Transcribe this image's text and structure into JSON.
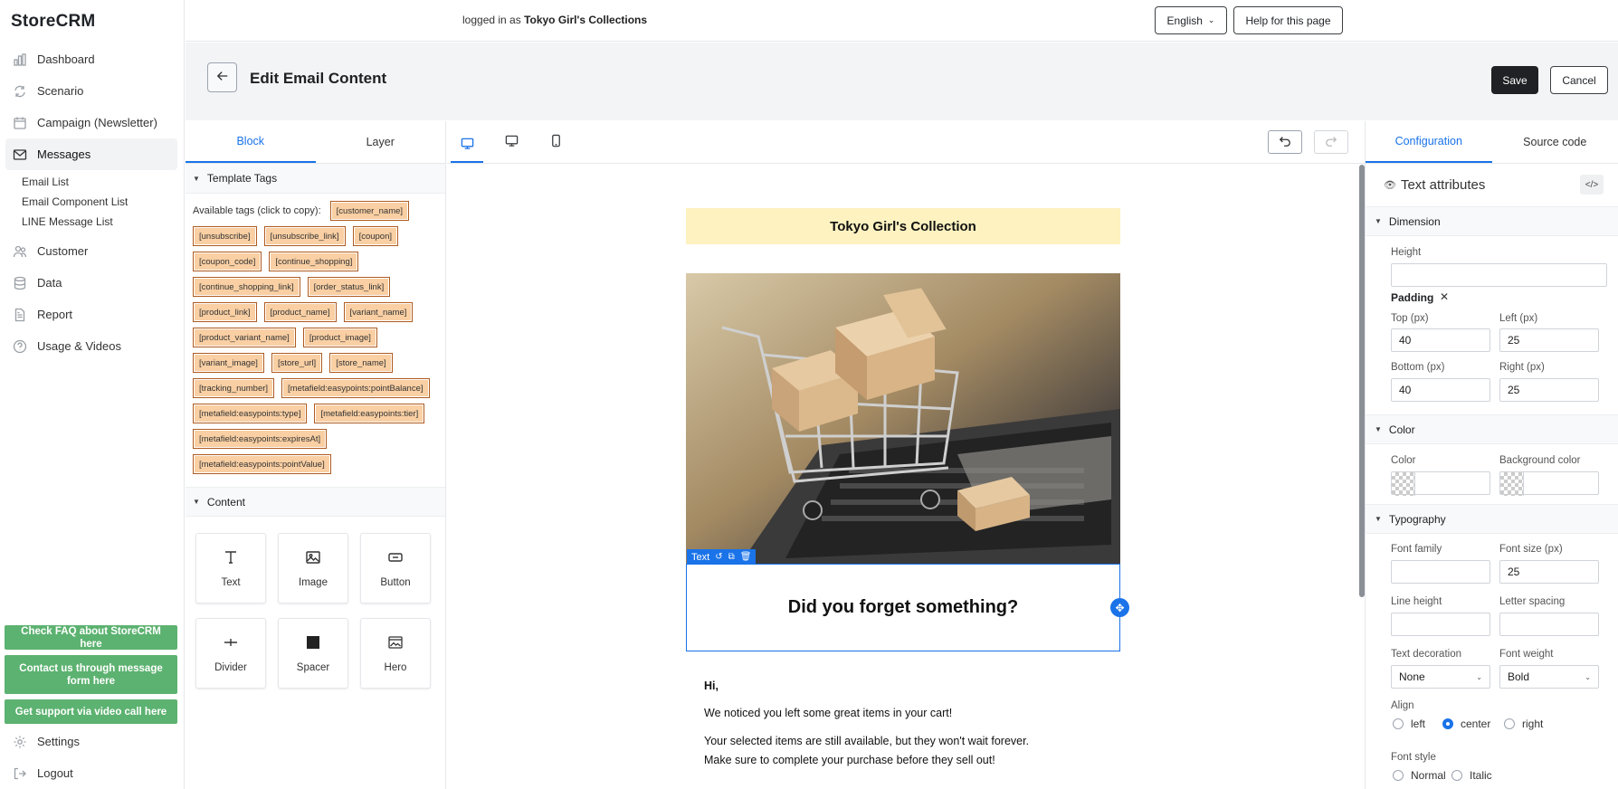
{
  "app": {
    "brand": "StoreCRM"
  },
  "sidebar": {
    "items": [
      {
        "label": "Dashboard",
        "icon": "bar-chart-icon"
      },
      {
        "label": "Scenario",
        "icon": "refresh-icon"
      },
      {
        "label": "Campaign (Newsletter)",
        "icon": "calendar-icon"
      },
      {
        "label": "Messages",
        "icon": "mail-icon"
      }
    ],
    "subitems": [
      "Email List",
      "Email Component List",
      "LINE Message List"
    ],
    "items2": [
      {
        "label": "Customer",
        "icon": "users-icon"
      },
      {
        "label": "Data",
        "icon": "database-icon"
      },
      {
        "label": "Report",
        "icon": "document-icon"
      },
      {
        "label": "Usage & Videos",
        "icon": "question-icon"
      }
    ],
    "help_buttons": [
      "Check FAQ about StoreCRM here",
      "Contact us through message form here",
      "Get support via video call here"
    ],
    "bottom": [
      {
        "label": "Settings",
        "icon": "gear-icon"
      },
      {
        "label": "Logout",
        "icon": "logout-icon"
      }
    ],
    "help_color": "#5cb270"
  },
  "topbar": {
    "logged_prefix": "logged in as ",
    "store": "Tokyo Girl's Collections",
    "language": "English",
    "help_page": "Help for this page"
  },
  "page": {
    "title": "Edit Email Content",
    "save": "Save",
    "cancel": "Cancel"
  },
  "left_panel": {
    "tabs": [
      "Block",
      "Layer"
    ],
    "template_tags_title": "Template Tags",
    "tags_label": "Available tags (click to copy):",
    "tags": [
      "[customer_name]",
      "[unsubscribe]",
      "[unsubscribe_link]",
      "[coupon]",
      "[coupon_code]",
      "[continue_shopping]",
      "[continue_shopping_link]",
      "[order_status_link]",
      "[product_link]",
      "[product_name]",
      "[variant_name]",
      "[product_variant_name]",
      "[product_image]",
      "[variant_image]",
      "[store_url]",
      "[store_name]",
      "[tracking_number]",
      "[metafield:easypoints:pointBalance]",
      "[metafield:easypoints:type]",
      "[metafield:easypoints:tier]",
      "[metafield:easypoints:expiresAt]",
      "[metafield:easypoints:pointValue]"
    ],
    "content_title": "Content",
    "blocks": [
      "Text",
      "Image",
      "Button",
      "Divider",
      "Spacer",
      "Hero"
    ]
  },
  "email": {
    "header": "Tokyo Girl's Collection",
    "badge": "Text",
    "headline": "Did you forget something?",
    "greeting": "Hi,",
    "p1": "We noticed you left some great items in your cart!",
    "p2a": "Your selected items are still available, but they won't wait forever.",
    "p2b": "Make sure to complete your purchase before they sell out!"
  },
  "right_panel": {
    "tabs": [
      "Configuration",
      "Source code"
    ],
    "title": "Text attributes",
    "dimension": "Dimension",
    "height_label": "Height",
    "height_value": "",
    "padding_label": "Padding",
    "top_label": "Top (px)",
    "top_value": "40",
    "left_label": "Left (px)",
    "left_value": "25",
    "bottom_label": "Bottom (px)",
    "bottom_value": "40",
    "right_label": "Right (px)",
    "right_value": "25",
    "color_section": "Color",
    "color_label": "Color",
    "bg_color_label": "Background color",
    "typography": "Typography",
    "font_family_label": "Font family",
    "font_family_value": "",
    "font_size_label": "Font size (px)",
    "font_size_value": "25",
    "line_height_label": "Line height",
    "letter_spacing_label": "Letter spacing",
    "text_decoration_label": "Text decoration",
    "text_decoration_value": "None",
    "font_weight_label": "Font weight",
    "font_weight_value": "Bold",
    "align_label": "Align",
    "align_options": [
      "left",
      "center",
      "right"
    ],
    "align_selected": "center",
    "font_style_label": "Font style",
    "font_style_options": [
      "Normal",
      "Italic"
    ]
  },
  "colors": {
    "accent": "#1a73e8",
    "header_bg": "#fdf2c0",
    "tag_bg": "#f9cfa3",
    "tag_border": "#b05a1f"
  }
}
